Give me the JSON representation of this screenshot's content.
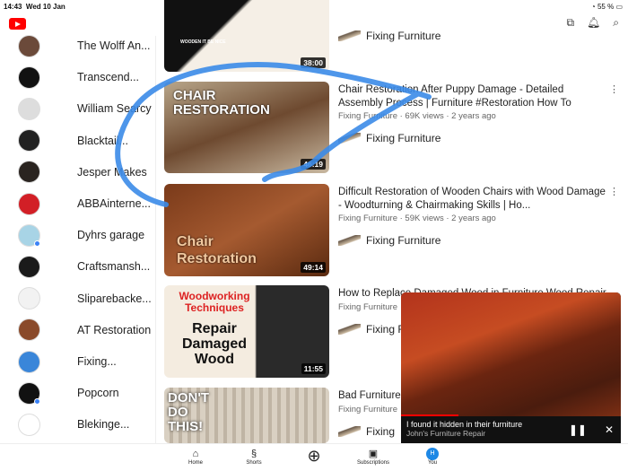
{
  "status": {
    "time": "14:43",
    "date": "Wed 10 Jan",
    "battery": "55 %"
  },
  "header": {
    "icons": [
      "cast-icon",
      "bell-icon",
      "search-icon"
    ]
  },
  "sidebar": {
    "items": [
      {
        "name": "The Wolff An...",
        "color": "#6b4a3a"
      },
      {
        "name": "Transcend...",
        "color": "#111"
      },
      {
        "name": "William Searcy",
        "color": "#ddd"
      },
      {
        "name": "Blacktail...",
        "color": "#222"
      },
      {
        "name": "Jesper Makes",
        "color": "#2a2420"
      },
      {
        "name": "ABBAinterne...",
        "color": "#d21f26"
      },
      {
        "name": "Dyhrs garage",
        "color": "#a8d4e6",
        "dot": true
      },
      {
        "name": "Craftsmansh...",
        "color": "#1a1a1a"
      },
      {
        "name": "Sliparebacke...",
        "color": "#f2f2f2"
      },
      {
        "name": "AT Restoration",
        "color": "#8a4a2a"
      },
      {
        "name": "Fixing...",
        "color": "#3a86d9"
      },
      {
        "name": "Popcorn",
        "color": "#111",
        "dot": true
      },
      {
        "name": "Blekinge...",
        "color": "#fff"
      }
    ]
  },
  "videos": [
    {
      "title": "",
      "meta": "",
      "channel": "Fixing Furniture",
      "duration": "38:00",
      "thumb_text": "WOODEN IT BE NICE"
    },
    {
      "title": "Chair Restoration After Puppy Damage - Detailed Assembly Process | Furniture #Restoration How To",
      "meta": "Fixing Furniture · 69K views · 2 years ago",
      "channel": "Fixing Furniture",
      "duration": "46:19",
      "thumb_text": "CHAIR RESTORATION"
    },
    {
      "title": "Difficult Restoration of Wooden Chairs with Wood Damage - Woodturning & Chairmaking Skills | Ho...",
      "meta": "Fixing Furniture · 59K views · 2 years ago",
      "channel": "Fixing Furniture",
      "duration": "49:14",
      "thumb_text": "Chair Restoration"
    },
    {
      "title": "How to Replace Damaged Wood in Furniture Wood Repair",
      "meta": "Fixing Furniture",
      "channel": "Fixing Furniture",
      "duration": "11:55",
      "thumb_text_a": "Woodworking Techniques",
      "thumb_text_b": "Repair Damaged Wood"
    },
    {
      "title": "Bad Furniture Furniture Re",
      "meta": "Fixing Furniture",
      "channel": "Fixing",
      "duration": "",
      "thumb_text": "DON'T DO THIS!"
    }
  ],
  "miniplayer": {
    "title": "I found it hidden in their furniture",
    "channel": "John's Furniture Repair",
    "progress": 0.26
  },
  "nav": {
    "home": "Home",
    "shorts": "Shorts",
    "subscriptions": "Subscriptions",
    "you": "You",
    "avatar_letter": "H"
  },
  "colors": {
    "brand": "#ff0000",
    "annotation": "#3b8be8"
  }
}
